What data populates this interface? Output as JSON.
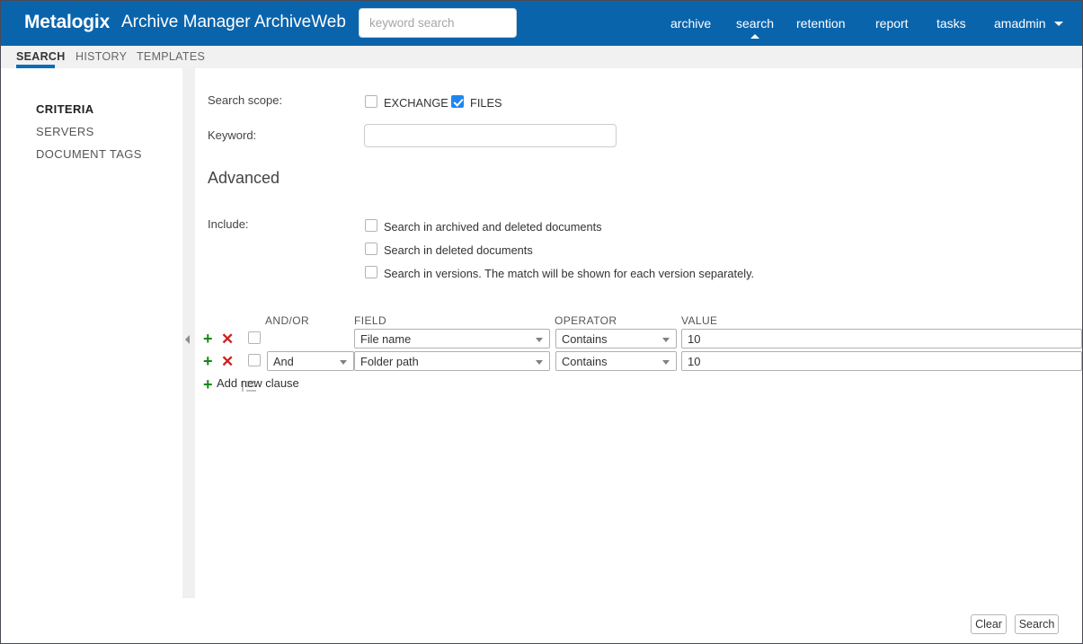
{
  "header": {
    "brand": "Metalogix",
    "app_title": "Archive Manager ArchiveWeb",
    "search_placeholder": "keyword search",
    "search_value": "",
    "brand_bg": "#0a64ac",
    "nav": [
      {
        "label": "archive",
        "active": false
      },
      {
        "label": "search",
        "active": true
      },
      {
        "label": "retention",
        "active": false
      },
      {
        "label": "report",
        "active": false
      },
      {
        "label": "tasks",
        "active": false
      },
      {
        "label": "amadmin",
        "active": false,
        "has_caret": true
      }
    ]
  },
  "subtabs": [
    {
      "label": "SEARCH",
      "active": true
    },
    {
      "label": "HISTORY",
      "active": false
    },
    {
      "label": "TEMPLATES",
      "active": false
    }
  ],
  "sidebar": {
    "items": [
      {
        "label": "CRITERIA",
        "active": true
      },
      {
        "label": "SERVERS",
        "active": false
      },
      {
        "label": "DOCUMENT TAGS",
        "active": false
      }
    ]
  },
  "main": {
    "scope_label": "Search scope:",
    "scope_options": [
      {
        "label": "EXCHANGE",
        "checked": false
      },
      {
        "label": "FILES",
        "checked": true
      }
    ],
    "keyword_label": "Keyword:",
    "keyword_value": "",
    "advanced_title": "Advanced",
    "include_label": "Include:",
    "include_options": [
      {
        "label": "Search in archived and deleted documents",
        "checked": false
      },
      {
        "label": "Search in deleted documents",
        "checked": false
      },
      {
        "label": "Search in versions. The match will be shown for each version separately.",
        "checked": false
      }
    ],
    "clause_columns": [
      "AND/OR",
      "FIELD",
      "OPERATOR",
      "VALUE"
    ],
    "clause_rows": [
      {
        "selected": false,
        "andor": "",
        "has_andor": false,
        "field": "File name",
        "operator": "Contains",
        "value": "10"
      },
      {
        "selected": false,
        "andor": "And",
        "has_andor": true,
        "field": "Folder path",
        "operator": "Contains",
        "value": "10"
      }
    ],
    "add_clause_label": "Add new clause",
    "add_icon": "+",
    "remove_icon": "✕"
  },
  "footer": {
    "clear_label": "Clear",
    "search_label": "Search"
  },
  "colors": {
    "brand_blue": "#0a64ac",
    "tab_underline": "#0a6db5",
    "checkbox_blue": "#1e86f0",
    "plus_green": "#128a12",
    "x_red": "#cc2020"
  }
}
